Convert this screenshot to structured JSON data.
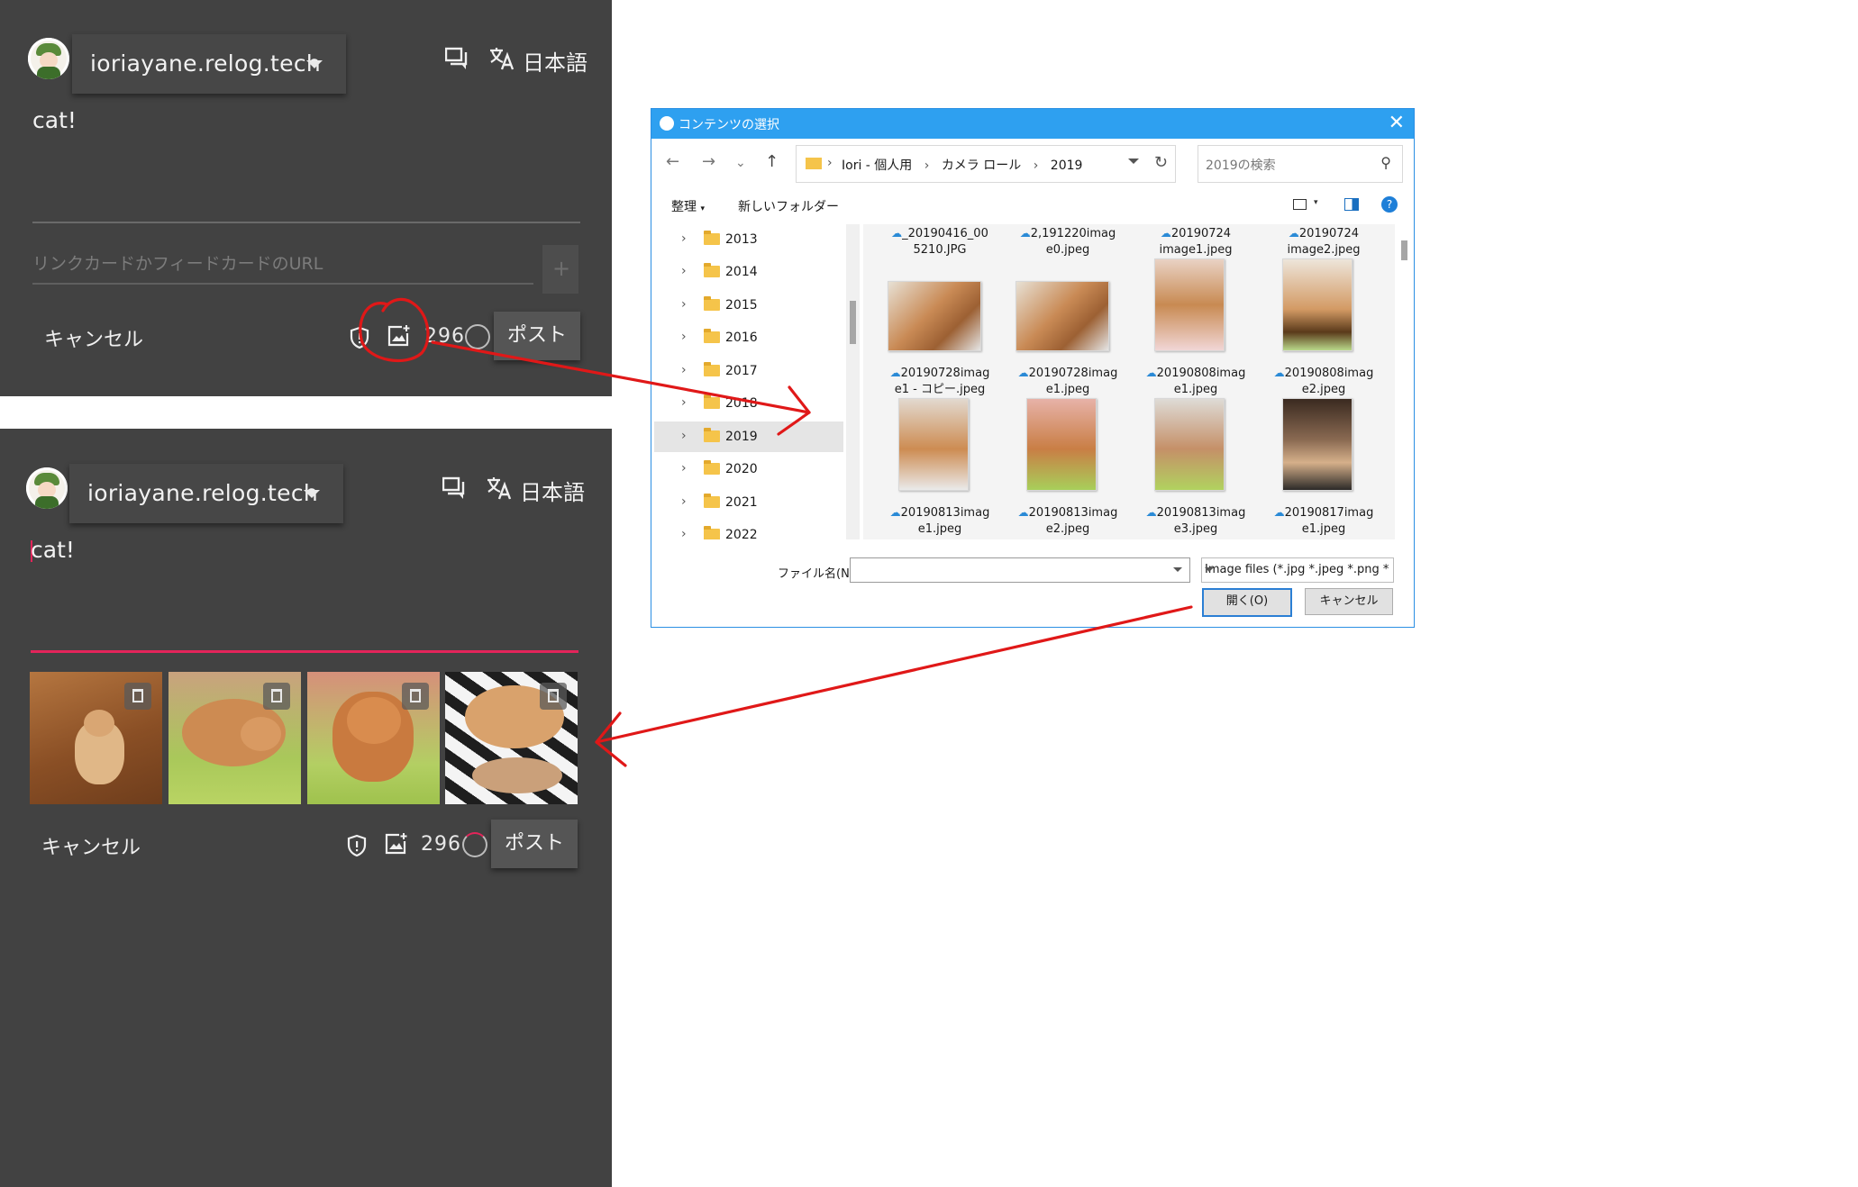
{
  "composer_top": {
    "domain": "ioriayane.relog.tech",
    "language_label": "日本語",
    "post_text": "cat!",
    "url_placeholder": "リンクカードかフィードカードのURL",
    "cancel_label": "キャンセル",
    "char_count": "296",
    "post_label": "ポスト"
  },
  "composer_bottom": {
    "domain": "ioriayane.relog.tech",
    "language_label": "日本語",
    "post_text": "cat!",
    "cancel_label": "キャンセル",
    "char_count": "296",
    "post_label": "ポスト",
    "attached_images": [
      "cat-photo-1",
      "cat-photo-2",
      "cat-photo-3",
      "cat-photo-4"
    ]
  },
  "dialog": {
    "title": "コンテンツの選択",
    "breadcrumb": [
      "Iori - 個人用",
      "カメラ ロール",
      "2019"
    ],
    "search_placeholder": "2019の検索",
    "toolbar": {
      "organize": "整理",
      "new_folder": "新しいフォルダー"
    },
    "folders": [
      "2013",
      "2014",
      "2015",
      "2016",
      "2017",
      "2018",
      "2019",
      "2020",
      "2021",
      "2022"
    ],
    "selected_folder": "2019",
    "files_top_row": [
      {
        "line1": "_20190416_00",
        "line2": "5210.JPG"
      },
      {
        "line1": "2,191220imag",
        "line2": "e0.jpeg"
      },
      {
        "line1": "20190724",
        "line2": "image1.jpeg"
      },
      {
        "line1": "20190724",
        "line2": "image2.jpeg"
      }
    ],
    "files_mid_row": [
      {
        "line1": "20190728imag",
        "line2": "e1 - コピー.jpeg"
      },
      {
        "line1": "20190728imag",
        "line2": "e1.jpeg"
      },
      {
        "line1": "20190808imag",
        "line2": "e1.jpeg"
      },
      {
        "line1": "20190808imag",
        "line2": "e2.jpeg"
      }
    ],
    "files_bottom_row": [
      {
        "line1": "20190813imag",
        "line2": "e1.jpeg"
      },
      {
        "line1": "20190813imag",
        "line2": "e2.jpeg"
      },
      {
        "line1": "20190813imag",
        "line2": "e3.jpeg"
      },
      {
        "line1": "20190817imag",
        "line2": "e1.jpeg"
      }
    ],
    "filename_label": "ファイル名(N):",
    "filename_value": "",
    "filetype": "Image files (*.jpg *.jpeg *.png *",
    "open_label": "開く(O)",
    "cancel_label": "キャンセル"
  },
  "colors": {
    "panel_bg": "#424242",
    "accent_pink": "#e3245a",
    "annotation_red": "#e01818",
    "dialog_title_bg": "#2ea0f0"
  }
}
